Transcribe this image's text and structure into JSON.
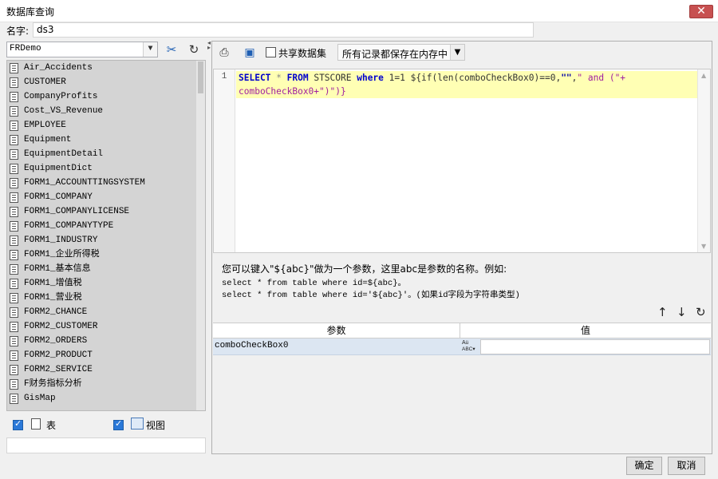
{
  "window": {
    "title": "数据库查询",
    "close_symbol": "✕"
  },
  "name_row": {
    "label": "名字:",
    "value": "ds3"
  },
  "left": {
    "connection": "FRDemo",
    "tables": [
      "Air_Accidents",
      "CUSTOMER",
      "CompanyProfits",
      "Cost_VS_Revenue",
      "EMPLOYEE",
      "Equipment",
      "EquipmentDetail",
      "EquipmentDict",
      "FORM1_ACCOUNTTINGSYSTEM",
      "FORM1_COMPANY",
      "FORM1_COMPANYLICENSE",
      "FORM1_COMPANYTYPE",
      "FORM1_INDUSTRY",
      "FORM1_企业所得税",
      "FORM1_基本信息",
      "FORM1_增值税",
      "FORM1_营业税",
      "FORM2_CHANCE",
      "FORM2_CUSTOMER",
      "FORM2_ORDERS",
      "FORM2_PRODUCT",
      "FORM2_SERVICE",
      "F财务指标分析",
      "GisMap"
    ],
    "filter_table_label": "表",
    "filter_table_checked": true,
    "filter_view_label": "视图",
    "filter_view_checked": true,
    "search_value": ""
  },
  "toolbar": {
    "share_label": "共享数据集",
    "share_checked": false,
    "store_mode": "所有记录都保存在内存中"
  },
  "editor": {
    "line_numbers": [
      "1"
    ],
    "code_line1": {
      "kw_select": "SELECT",
      "star": " * ",
      "kw_from": "FROM",
      "table": " STSCORE ",
      "kw_where": "where",
      "cond": " 1=1 ${if(len(comboCheckBox0)==0,",
      "str1": "\"\"",
      "comma": ",",
      "str2": "\" and (\"+",
      "_note": ""
    },
    "code_line2": {
      "text": "comboCheckBox0+\")\")}"
    }
  },
  "hint": {
    "line1": "您可以键入\"${abc}\"做为一个参数，这里abc是参数的名称。例如:",
    "line2": "select * from table where id=${abc}。",
    "line3": "select * from table where id='${abc}'。(如果id字段为字符串类型)"
  },
  "params": {
    "col_name": "参数",
    "col_value": "值",
    "rows": [
      {
        "name": "comboCheckBox0",
        "type_icon_text": "ABC",
        "value": ""
      }
    ]
  },
  "buttons": {
    "ok": "确定",
    "cancel": "取消"
  },
  "icons": {
    "connect": "connect-icon",
    "refresh": "refresh-icon",
    "preview": "preview-icon",
    "param": "parameter-icon",
    "up": "arrow-up-icon",
    "down": "arrow-down-icon"
  }
}
